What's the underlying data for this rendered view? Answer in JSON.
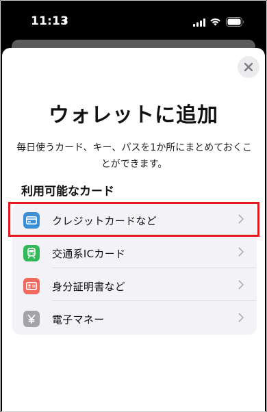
{
  "status_bar": {
    "time": "11:13"
  },
  "sheet": {
    "title": "ウォレットに追加",
    "subtitle": "毎日使うカード、キー、パスを1か所にまとめておくことができます。",
    "section_title": "利用可能なカード",
    "items": [
      {
        "label": "クレジットカードなど",
        "icon": "credit-card-icon",
        "color": "#3a8fd6"
      },
      {
        "label": "交通系ICカード",
        "icon": "train-icon",
        "color": "#34b95a"
      },
      {
        "label": "身分証明書など",
        "icon": "id-card-icon",
        "color": "#f06a5e"
      },
      {
        "label": "電子マネー",
        "icon": "yen-icon",
        "color": "#a3a3a8"
      }
    ]
  },
  "highlight_color": "#e3191f"
}
